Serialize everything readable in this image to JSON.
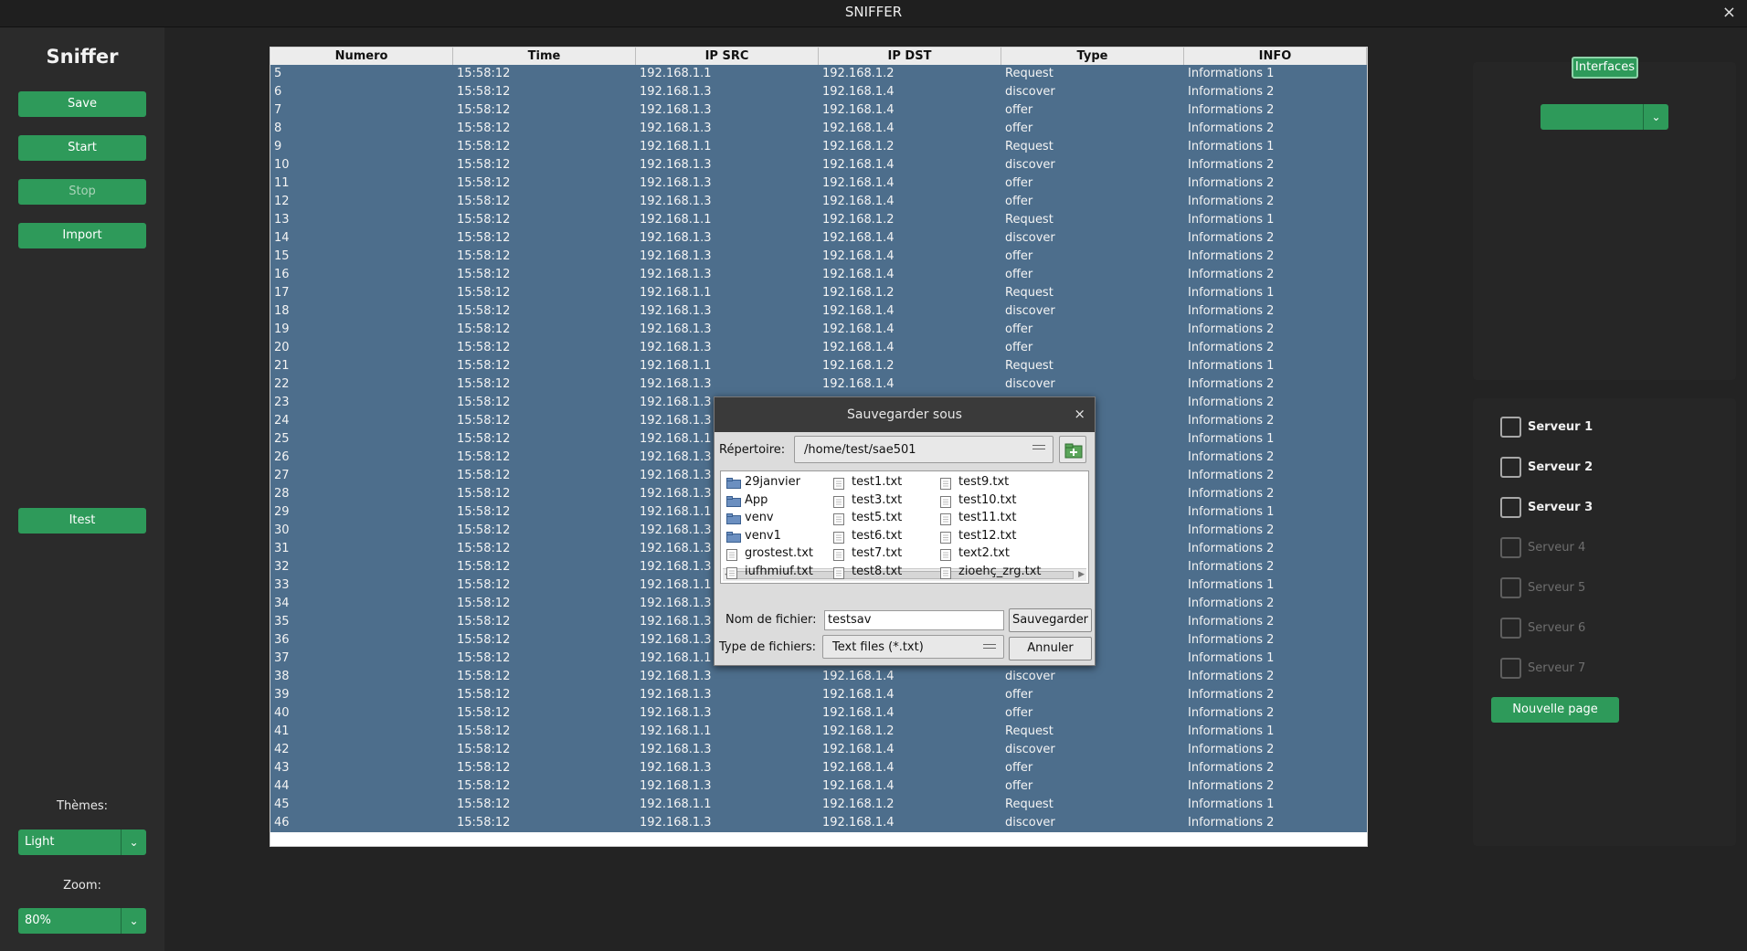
{
  "window": {
    "title": "SNIFFER",
    "close_glyph": "×"
  },
  "sidebar": {
    "brand": "Sniffer",
    "buttons": {
      "save": "Save",
      "start": "Start",
      "stop": "Stop",
      "import": "Import",
      "itest": "Itest"
    },
    "themes_label": "Thèmes:",
    "theme_value": "Light",
    "zoom_label": "Zoom:",
    "zoom_value": "80%"
  },
  "table": {
    "headers": [
      "Numero",
      "Time",
      "IP SRC",
      "IP DST",
      "Type",
      "INFO"
    ],
    "rows": [
      [
        "5",
        "15:58:12",
        "192.168.1.1",
        "192.168.1.2",
        "Request",
        "Informations 1"
      ],
      [
        "6",
        "15:58:12",
        "192.168.1.3",
        "192.168.1.4",
        "discover",
        "Informations 2"
      ],
      [
        "7",
        "15:58:12",
        "192.168.1.3",
        "192.168.1.4",
        "offer",
        "Informations 2"
      ],
      [
        "8",
        "15:58:12",
        "192.168.1.3",
        "192.168.1.4",
        "offer",
        "Informations 2"
      ],
      [
        "9",
        "15:58:12",
        "192.168.1.1",
        "192.168.1.2",
        "Request",
        "Informations 1"
      ],
      [
        "10",
        "15:58:12",
        "192.168.1.3",
        "192.168.1.4",
        "discover",
        "Informations 2"
      ],
      [
        "11",
        "15:58:12",
        "192.168.1.3",
        "192.168.1.4",
        "offer",
        "Informations 2"
      ],
      [
        "12",
        "15:58:12",
        "192.168.1.3",
        "192.168.1.4",
        "offer",
        "Informations 2"
      ],
      [
        "13",
        "15:58:12",
        "192.168.1.1",
        "192.168.1.2",
        "Request",
        "Informations 1"
      ],
      [
        "14",
        "15:58:12",
        "192.168.1.3",
        "192.168.1.4",
        "discover",
        "Informations 2"
      ],
      [
        "15",
        "15:58:12",
        "192.168.1.3",
        "192.168.1.4",
        "offer",
        "Informations 2"
      ],
      [
        "16",
        "15:58:12",
        "192.168.1.3",
        "192.168.1.4",
        "offer",
        "Informations 2"
      ],
      [
        "17",
        "15:58:12",
        "192.168.1.1",
        "192.168.1.2",
        "Request",
        "Informations 1"
      ],
      [
        "18",
        "15:58:12",
        "192.168.1.3",
        "192.168.1.4",
        "discover",
        "Informations 2"
      ],
      [
        "19",
        "15:58:12",
        "192.168.1.3",
        "192.168.1.4",
        "offer",
        "Informations 2"
      ],
      [
        "20",
        "15:58:12",
        "192.168.1.3",
        "192.168.1.4",
        "offer",
        "Informations 2"
      ],
      [
        "21",
        "15:58:12",
        "192.168.1.1",
        "192.168.1.2",
        "Request",
        "Informations 1"
      ],
      [
        "22",
        "15:58:12",
        "192.168.1.3",
        "192.168.1.4",
        "discover",
        "Informations 2"
      ],
      [
        "23",
        "15:58:12",
        "192.168.1.3",
        "",
        "",
        "Informations 2"
      ],
      [
        "24",
        "15:58:12",
        "192.168.1.3",
        "",
        "",
        "Informations 2"
      ],
      [
        "25",
        "15:58:12",
        "192.168.1.1",
        "",
        "",
        "Informations 1"
      ],
      [
        "26",
        "15:58:12",
        "192.168.1.3",
        "",
        "",
        "Informations 2"
      ],
      [
        "27",
        "15:58:12",
        "192.168.1.3",
        "",
        "",
        "Informations 2"
      ],
      [
        "28",
        "15:58:12",
        "192.168.1.3",
        "",
        "",
        "Informations 2"
      ],
      [
        "29",
        "15:58:12",
        "192.168.1.1",
        "",
        "",
        "Informations 1"
      ],
      [
        "30",
        "15:58:12",
        "192.168.1.3",
        "",
        "",
        "Informations 2"
      ],
      [
        "31",
        "15:58:12",
        "192.168.1.3",
        "",
        "",
        "Informations 2"
      ],
      [
        "32",
        "15:58:12",
        "192.168.1.3",
        "",
        "",
        "Informations 2"
      ],
      [
        "33",
        "15:58:12",
        "192.168.1.1",
        "",
        "",
        "Informations 1"
      ],
      [
        "34",
        "15:58:12",
        "192.168.1.3",
        "",
        "",
        "Informations 2"
      ],
      [
        "35",
        "15:58:12",
        "192.168.1.3",
        "",
        "",
        "Informations 2"
      ],
      [
        "36",
        "15:58:12",
        "192.168.1.3",
        "",
        "",
        "Informations 2"
      ],
      [
        "37",
        "15:58:12",
        "192.168.1.1",
        "",
        "",
        "Informations 1"
      ],
      [
        "38",
        "15:58:12",
        "192.168.1.3",
        "192.168.1.4",
        "discover",
        "Informations 2"
      ],
      [
        "39",
        "15:58:12",
        "192.168.1.3",
        "192.168.1.4",
        "offer",
        "Informations 2"
      ],
      [
        "40",
        "15:58:12",
        "192.168.1.3",
        "192.168.1.4",
        "offer",
        "Informations 2"
      ],
      [
        "41",
        "15:58:12",
        "192.168.1.1",
        "192.168.1.2",
        "Request",
        "Informations 1"
      ],
      [
        "42",
        "15:58:12",
        "192.168.1.3",
        "192.168.1.4",
        "discover",
        "Informations 2"
      ],
      [
        "43",
        "15:58:12",
        "192.168.1.3",
        "192.168.1.4",
        "offer",
        "Informations 2"
      ],
      [
        "44",
        "15:58:12",
        "192.168.1.3",
        "192.168.1.4",
        "offer",
        "Informations 2"
      ],
      [
        "45",
        "15:58:12",
        "192.168.1.1",
        "192.168.1.2",
        "Request",
        "Informations 1"
      ],
      [
        "46",
        "15:58:12",
        "192.168.1.3",
        "192.168.1.4",
        "discover",
        "Informations 2"
      ]
    ]
  },
  "right_panel": {
    "interfaces_label": "Interfaces",
    "servers": [
      {
        "label": "Serveur 1",
        "enabled": true
      },
      {
        "label": "Serveur 2",
        "enabled": true
      },
      {
        "label": "Serveur 3",
        "enabled": true
      },
      {
        "label": "Serveur 4",
        "enabled": false
      },
      {
        "label": "Serveur 5",
        "enabled": false
      },
      {
        "label": "Serveur 6",
        "enabled": false
      },
      {
        "label": "Serveur 7",
        "enabled": false
      }
    ],
    "new_page_label": "Nouvelle page"
  },
  "dialog": {
    "title": "Sauvegarder sous",
    "directory_label": "Répertoire:",
    "directory_value": "/home/test/sae501",
    "files": [
      {
        "name": "29janvier",
        "kind": "folder"
      },
      {
        "name": "App",
        "kind": "folder"
      },
      {
        "name": "venv",
        "kind": "folder"
      },
      {
        "name": "venv1",
        "kind": "folder"
      },
      {
        "name": "grostest.txt",
        "kind": "file"
      },
      {
        "name": "iufhmiuf.txt",
        "kind": "file"
      },
      {
        "name": "test1.txt",
        "kind": "file"
      },
      {
        "name": "test3.txt",
        "kind": "file"
      },
      {
        "name": "test5.txt",
        "kind": "file"
      },
      {
        "name": "test6.txt",
        "kind": "file"
      },
      {
        "name": "test7.txt",
        "kind": "file"
      },
      {
        "name": "test8.txt",
        "kind": "file"
      },
      {
        "name": "test9.txt",
        "kind": "file"
      },
      {
        "name": "test10.txt",
        "kind": "file"
      },
      {
        "name": "test11.txt",
        "kind": "file"
      },
      {
        "name": "test12.txt",
        "kind": "file"
      },
      {
        "name": "text2.txt",
        "kind": "file"
      },
      {
        "name": "zioehç_zrg.txt",
        "kind": "file"
      }
    ],
    "filename_label": "Nom de fichier:",
    "filename_value": "testsav",
    "filetype_label": "Type de fichiers:",
    "filetype_value": "Text files (*.txt)",
    "save_button": "Sauvegarder",
    "cancel_button": "Annuler"
  },
  "colors": {
    "accent": "#2e9a5a",
    "table_row_bg": "#4d6e8c",
    "app_bg": "#232323"
  }
}
